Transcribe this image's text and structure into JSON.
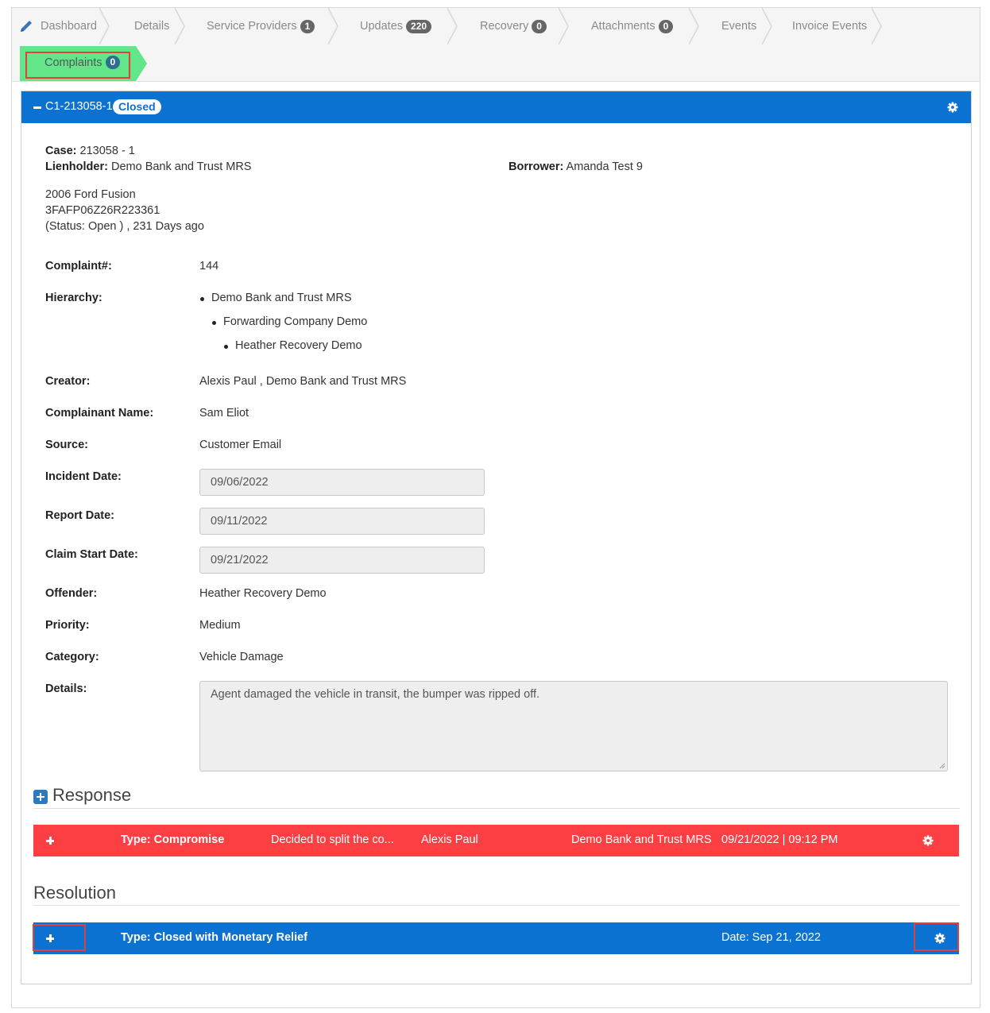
{
  "tabs": [
    {
      "label": "Dashboard"
    },
    {
      "label": "Details"
    },
    {
      "label": "Service Providers",
      "badge": "1"
    },
    {
      "label": "Updates",
      "badge": "220"
    },
    {
      "label": "Recovery",
      "badge": "0"
    },
    {
      "label": "Attachments",
      "badge": "0"
    },
    {
      "label": "Events"
    },
    {
      "label": "Invoice Events"
    },
    {
      "label": "Complaints",
      "badge": "0"
    }
  ],
  "panel": {
    "title": "C1-213058-1",
    "status": "Closed"
  },
  "case": {
    "case_label": "Case:",
    "case_value": "213058 - 1",
    "lienholder_label": "Lienholder:",
    "lienholder_value": "Demo Bank and Trust MRS",
    "borrower_label": "Borrower:",
    "borrower_value": "Amanda Test 9",
    "vehicle": "2006 Ford Fusion",
    "vin": "3FAFP06Z26R223361",
    "status_line": "(Status: Open ) , 231 Days ago"
  },
  "complaint": {
    "number_label": "Complaint#:",
    "number": "144",
    "hierarchy_label": "Hierarchy:",
    "hierarchy": [
      "Demo Bank and Trust MRS",
      "Forwarding Company Demo",
      "Heather Recovery Demo"
    ],
    "creator_label": "Creator:",
    "creator": "Alexis Paul , Demo Bank and Trust MRS",
    "complainant_label": "Complainant Name:",
    "complainant": "Sam Eliot",
    "source_label": "Source:",
    "source": "Customer Email",
    "incident_label": "Incident Date:",
    "incident_date": "09/06/2022",
    "report_label": "Report Date:",
    "report_date": "09/11/2022",
    "claim_label": "Claim Start Date:",
    "claim_start_date": "09/21/2022",
    "offender_label": "Offender:",
    "offender": "Heather Recovery Demo",
    "priority_label": "Priority:",
    "priority": "Medium",
    "category_label": "Category:",
    "category": "Vehicle Damage",
    "details_label": "Details:",
    "details": "Agent damaged the vehicle in transit, the bumper was ripped off."
  },
  "response": {
    "heading": "Response",
    "row": {
      "type": "Type: Compromise",
      "summary": "Decided to split the co...",
      "user": "Alexis Paul",
      "company": "Demo Bank and Trust MRS",
      "datetime": "09/21/2022 | 09:12 PM"
    }
  },
  "resolution": {
    "heading": "Resolution",
    "row": {
      "type": "Type: Closed with Monetary Relief",
      "date": "Date: Sep 21, 2022"
    }
  },
  "colors": {
    "primary": "#0b72d1",
    "danger": "#fc3f42",
    "active_tab": "#63e68a",
    "highlight": "#e0413f"
  }
}
